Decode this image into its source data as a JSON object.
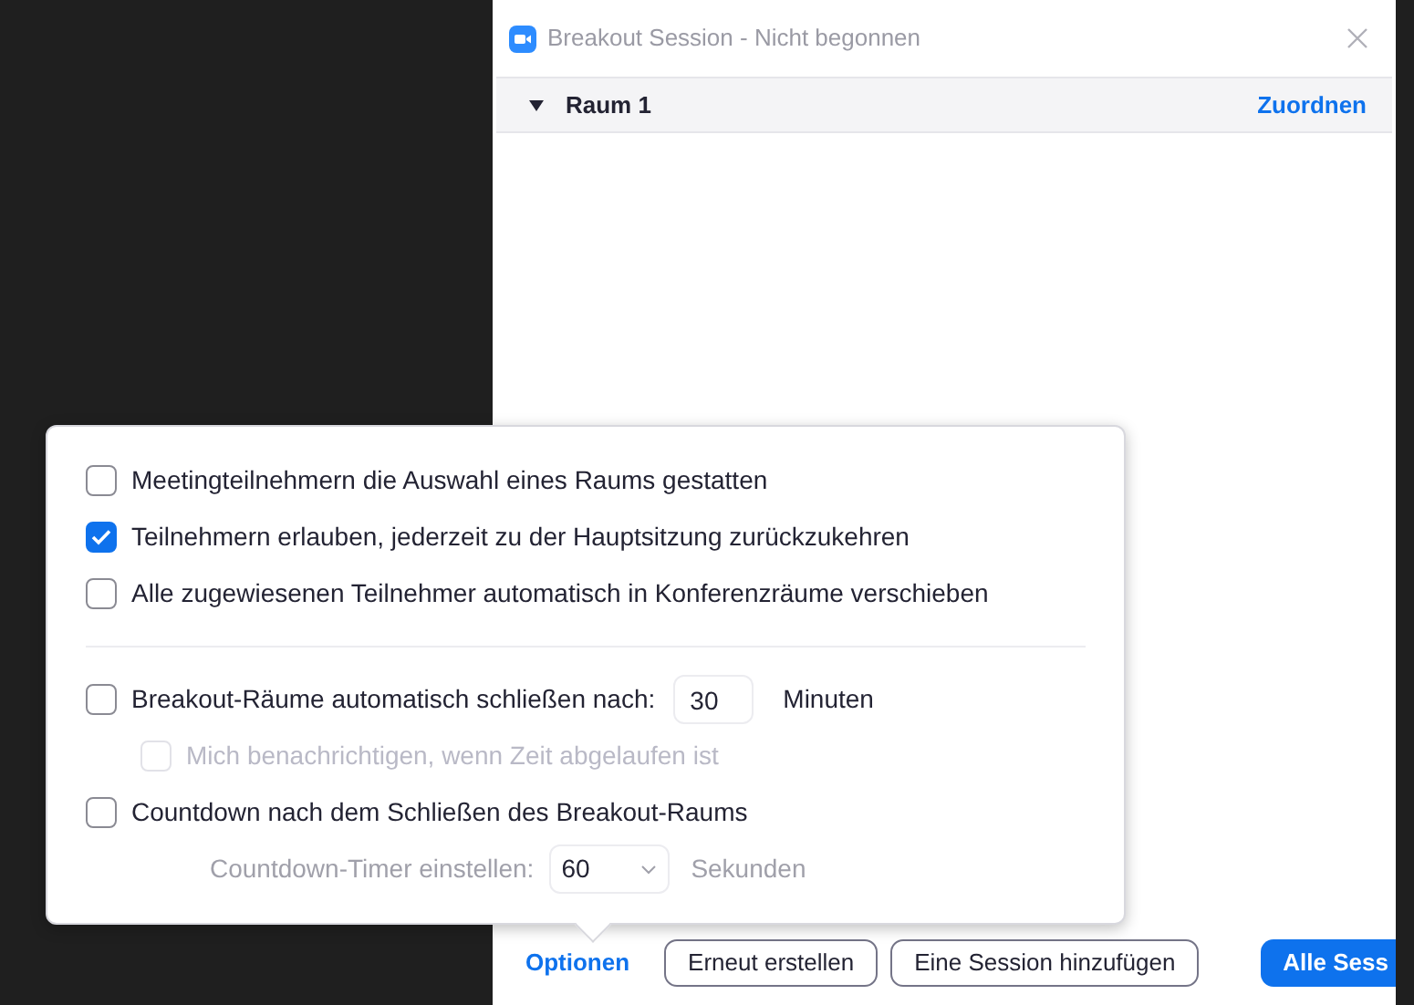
{
  "window": {
    "title": "Breakout Session - Nicht begonnen"
  },
  "rooms": [
    {
      "name": "Raum 1",
      "expanded": true,
      "action": "Zuordnen"
    }
  ],
  "options_popup": {
    "general": [
      {
        "label": "Meetingteilnehmern die Auswahl eines Raums gestatten",
        "checked": false
      },
      {
        "label": "Teilnehmern erlauben, jederzeit zu der Hauptsitzung zurückzukehren",
        "checked": true
      },
      {
        "label": "Alle zugewiesenen Teilnehmer automatisch in Konferenzräume verschieben",
        "checked": false
      }
    ],
    "timers": [
      {
        "kind": "number",
        "label": "Breakout-Räume automatisch schließen nach:",
        "checked": false,
        "value": "30",
        "unit": "Minuten",
        "children": [
          {
            "kind": "checkbox",
            "label": "Mich benachrichtigen, wenn Zeit abgelaufen ist",
            "checked": false,
            "disabled": true
          }
        ]
      },
      {
        "kind": "checkbox",
        "label": "Countdown nach dem Schließen des Breakout-Raums",
        "checked": false,
        "children": [
          {
            "kind": "select",
            "label": "Countdown-Timer einstellen:",
            "value": "60",
            "unit": "Sekunden",
            "disabled": true
          }
        ]
      }
    ]
  },
  "footer": [
    {
      "kind": "link",
      "label": "Optionen"
    },
    {
      "kind": "outline",
      "label": "Erneut erstellen"
    },
    {
      "kind": "outline",
      "label": "Eine Session hinzufügen"
    },
    {
      "kind": "primary",
      "label": "Alle Sess"
    }
  ]
}
